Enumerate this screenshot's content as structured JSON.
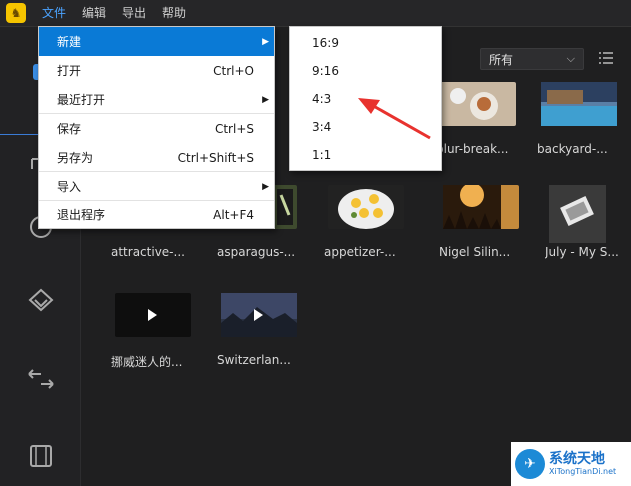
{
  "menubar": {
    "items": [
      "文件",
      "编辑",
      "导出",
      "帮助"
    ]
  },
  "filter": {
    "value": "所有"
  },
  "file_menu": {
    "items": [
      {
        "label": "新建",
        "shortcut": "",
        "submenu": true
      },
      {
        "label": "打开",
        "shortcut": "Ctrl+O",
        "submenu": false
      },
      {
        "label": "最近打开",
        "shortcut": "",
        "submenu": true
      },
      {
        "label": "保存",
        "shortcut": "Ctrl+S",
        "submenu": false
      },
      {
        "label": "另存为",
        "shortcut": "Ctrl+Shift+S",
        "submenu": false
      },
      {
        "label": "导入",
        "shortcut": "",
        "submenu": true
      },
      {
        "label": "退出程序",
        "shortcut": "Alt+F4",
        "submenu": false
      }
    ]
  },
  "new_submenu": {
    "items": [
      "16:9",
      "9:16",
      "4:3",
      "3:4",
      "1:1"
    ]
  },
  "media": {
    "items": [
      {
        "label": "blur-break...",
        "color": "#c9b8a2"
      },
      {
        "label": "backyard-...",
        "color": "#5a7fa6"
      },
      {
        "label": "attractive-...",
        "color": "#8a7a66"
      },
      {
        "label": "asparagus-...",
        "color": "#3e4a2e"
      },
      {
        "label": "appetizer-...",
        "color": "#d9d3c9"
      },
      {
        "label": "Nigel Silin...",
        "color": "#c48a3c"
      },
      {
        "label": "July - My S...",
        "color": "#555555"
      },
      {
        "label": "挪威迷人的...",
        "color": "#0e0e0e"
      },
      {
        "label": "Switzerlan...",
        "color": "#2c3446"
      }
    ]
  },
  "watermark": {
    "title": "系统天地",
    "subtitle": "XiTongTianDi.net"
  }
}
